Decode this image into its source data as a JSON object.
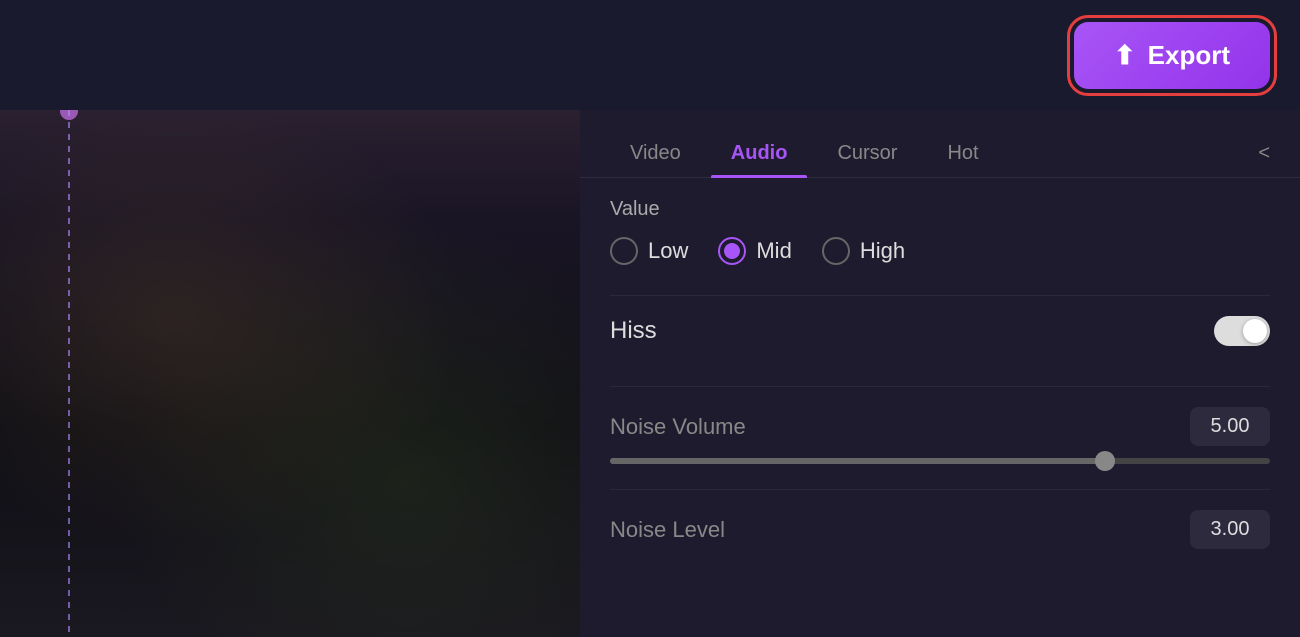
{
  "topbar": {
    "export_label": "Export"
  },
  "tabs": {
    "items": [
      {
        "id": "video",
        "label": "Video",
        "active": false
      },
      {
        "id": "audio",
        "label": "Audio",
        "active": true
      },
      {
        "id": "cursor",
        "label": "Cursor",
        "active": false
      },
      {
        "id": "hot",
        "label": "Hot",
        "active": false
      }
    ],
    "chevron": "<"
  },
  "settings": {
    "value_label": "Value",
    "radio_options": [
      {
        "id": "low",
        "label": "Low",
        "selected": false
      },
      {
        "id": "mid",
        "label": "Mid",
        "selected": true
      },
      {
        "id": "high",
        "label": "High",
        "selected": false
      }
    ],
    "hiss_label": "Hiss",
    "hiss_enabled": true,
    "noise_volume_label": "Noise Volume",
    "noise_volume_value": "5.00",
    "noise_volume_fill_pct": 75,
    "noise_volume_thumb_pct": 75,
    "noise_level_label": "Noise Level",
    "noise_level_value": "3.00"
  }
}
